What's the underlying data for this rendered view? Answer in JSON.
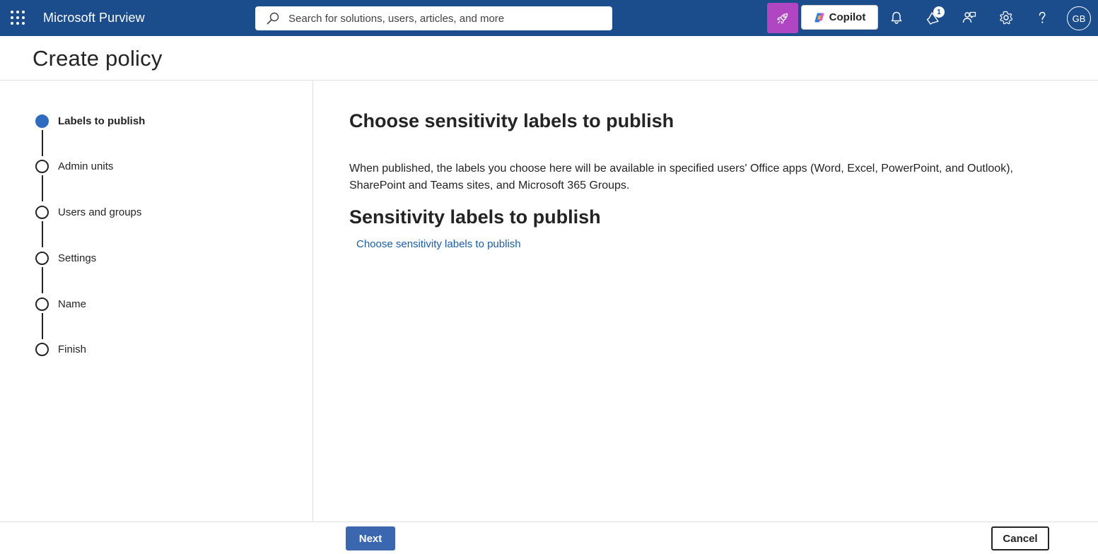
{
  "topbar": {
    "app_name": "Microsoft Purview",
    "search_placeholder": "Search for solutions, users, articles, and more",
    "copilot_label": "Copilot",
    "notification_badge": "1",
    "avatar_initials": "GB",
    "bar_color": "#1b4d8c",
    "rocket_color": "#b146c2"
  },
  "page": {
    "title": "Create policy"
  },
  "steps": [
    {
      "label": "Labels to publish",
      "state": "active"
    },
    {
      "label": "Admin units",
      "state": "pending"
    },
    {
      "label": "Users and groups",
      "state": "pending"
    },
    {
      "label": "Settings",
      "state": "pending"
    },
    {
      "label": "Name",
      "state": "pending"
    },
    {
      "label": "Finish",
      "state": "pending"
    }
  ],
  "main": {
    "heading": "Choose sensitivity labels to publish",
    "description": "When published, the labels you choose here will be available in specified users' Office apps (Word, Excel, PowerPoint, and Outlook), SharePoint and Teams sites, and Microsoft 365 Groups.",
    "subheading": "Sensitivity labels to publish",
    "choose_link": "Choose sensitivity labels to publish"
  },
  "footer": {
    "next_label": "Next",
    "cancel_label": "Cancel"
  },
  "colors": {
    "accent": "#2f6cc0",
    "link": "#1b5da8",
    "primary_button": "#3a67b0"
  }
}
